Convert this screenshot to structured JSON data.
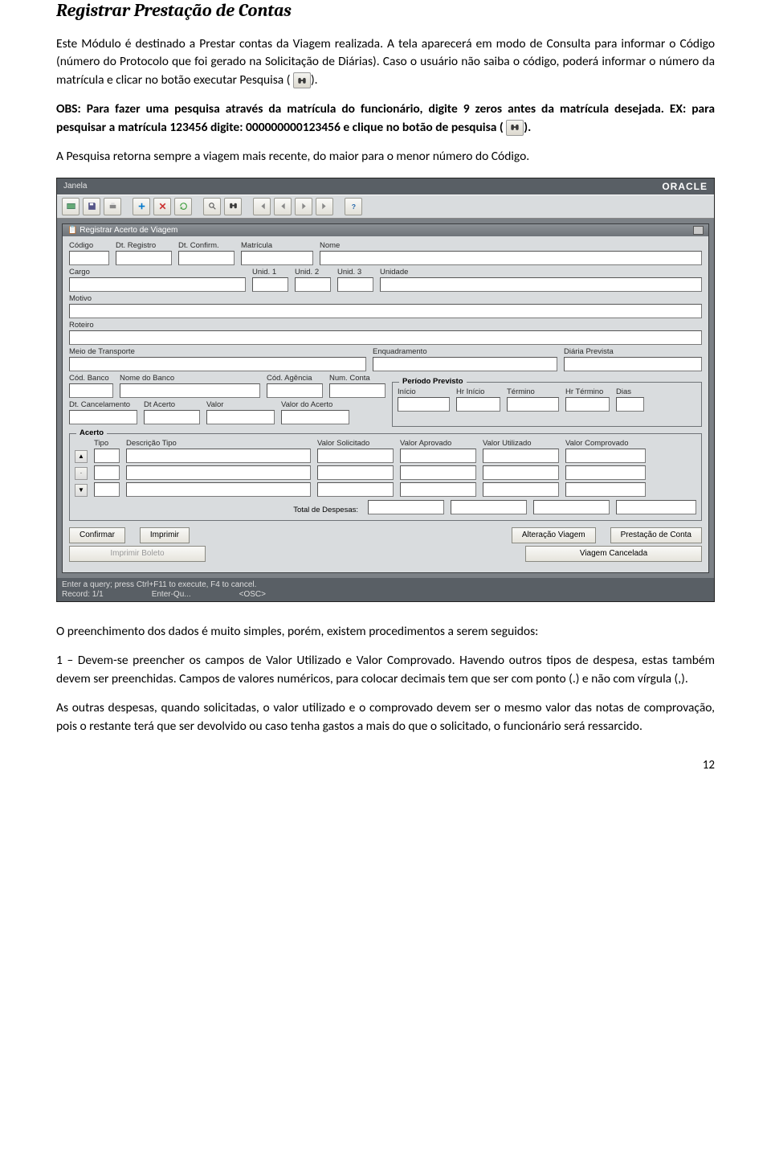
{
  "page_number": "12",
  "title": "Registrar Prestação de Contas",
  "intro_1": "Este Módulo é destinado a Prestar contas da Viagem realizada. A tela aparecerá em modo de Consulta para informar o Código (número do Protocolo que foi gerado na Solicitação de Diárias). Caso o usuário não saiba o código, poderá informar o número da matrícula e clicar no botão executar Pesquisa (",
  "intro_1b": ").",
  "obs_1": "OBS: Para fazer uma pesquisa através da matrícula do funcionário, digite 9 zeros antes da matrícula desejada. EX: para pesquisar a matrícula 123456 digite: 000000000123456 e clique no botão de pesquisa (",
  "obs_1b": ").",
  "para_after_obs": "A Pesquisa retorna sempre a viagem mais recente, do maior para o menor número do Código.",
  "para_fill": "O preenchimento dos dados é muito simples, porém, existem procedimentos a serem seguidos:",
  "proc_1": "1 – Devem-se preencher os campos de Valor Utilizado e Valor Comprovado. Havendo outros tipos de despesa, estas também devem ser preenchidas. Campos de valores numéricos, para colocar decimais tem que ser com ponto (.) e não com vírgula (,).",
  "proc_2": "As outras despesas, quando solicitadas, o valor utilizado e o comprovado devem ser o mesmo valor das notas de comprovação, pois o restante terá que ser devolvido ou caso tenha gastos a mais do que o solicitado, o funcionário será ressarcido.",
  "app": {
    "menu_label": "Janela",
    "brand": "ORACLE",
    "window_title": "Registrar Acerto de Viagem",
    "status_line": "Enter a query; press Ctrl+F11 to execute, F4 to cancel.",
    "record": "Record: 1/1",
    "mode": "Enter-Qu...",
    "osc": "<OSC>",
    "labels": {
      "codigo": "Código",
      "dt_registro": "Dt. Registro",
      "dt_confirm": "Dt. Confirm.",
      "matricula": "Matrícula",
      "nome": "Nome",
      "cargo": "Cargo",
      "unid1": "Unid. 1",
      "unid2": "Unid. 2",
      "unid3": "Unid. 3",
      "unidade": "Unidade",
      "motivo": "Motivo",
      "roteiro": "Roteiro",
      "meio_transporte": "Meio de Transporte",
      "enquadramento": "Enquadramento",
      "diaria_prevista": "Diária Prevista",
      "cod_banco": "Cód. Banco",
      "nome_banco": "Nome do Banco",
      "cod_agencia": "Cód. Agência",
      "num_conta": "Num. Conta",
      "periodo_previsto": "Período Previsto",
      "inicio": "Início",
      "hr_inicio": "Hr Início",
      "termino": "Término",
      "hr_termino": "Hr Término",
      "dias": "Dias",
      "dt_cancel": "Dt. Cancelamento",
      "dt_acerto": "Dt Acerto",
      "valor": "Valor",
      "valor_acerto": "Valor do Acerto",
      "acerto": "Acerto",
      "tipo": "Tipo",
      "desc_tipo": "Descrição Tipo",
      "valor_solicitado": "Valor Solicitado",
      "valor_aprovado": "Valor Aprovado",
      "valor_utilizado": "Valor Utilizado",
      "valor_comprovado": "Valor Comprovado",
      "total_despesas": "Total de Despesas:"
    },
    "buttons": {
      "confirmar": "Confirmar",
      "imprimir": "Imprimir",
      "imprimir_boleto": "Imprimir Boleto",
      "alteracao_viagem": "Alteração Viagem",
      "prestacao_conta": "Prestação de Conta",
      "viagem_cancelada": "Viagem Cancelada"
    }
  }
}
